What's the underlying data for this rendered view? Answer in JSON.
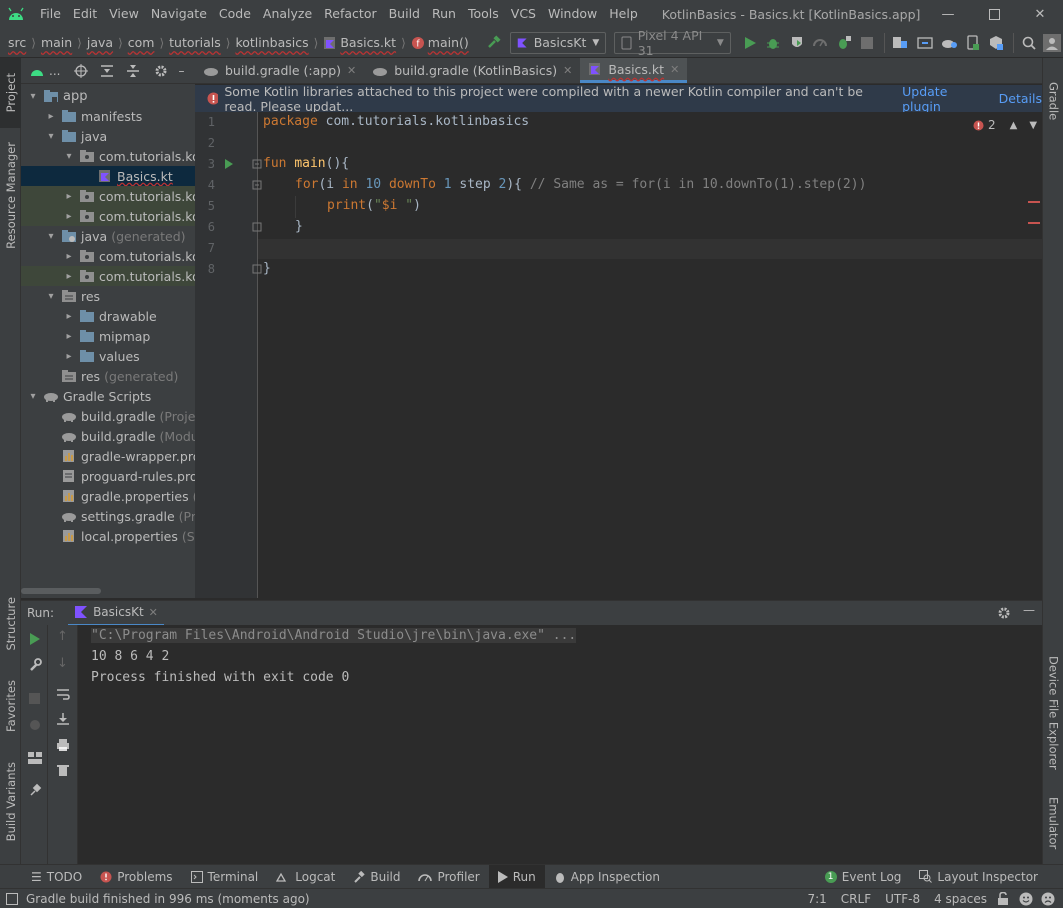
{
  "menu": [
    "File",
    "Edit",
    "View",
    "Navigate",
    "Code",
    "Analyze",
    "Refactor",
    "Build",
    "Run",
    "Tools",
    "VCS",
    "Window",
    "Help"
  ],
  "window_title": "KotlinBasics - Basics.kt [KotlinBasics.app]",
  "breadcrumbs": [
    "src",
    "main",
    "java",
    "com",
    "tutorials",
    "kotlinbasics",
    "Basics.kt",
    "main()"
  ],
  "run_config": "BasicsKt",
  "device": "Pixel 4 API 31",
  "left_tabs": {
    "project": "Project",
    "resource_manager": "Resource Manager",
    "structure": "Structure",
    "favorites": "Favorites",
    "build_variants": "Build Variants"
  },
  "right_tabs": {
    "gradle": "Gradle",
    "device_file_explorer": "Device File Explorer",
    "emulator": "Emulator"
  },
  "project_dropdown": "...",
  "tree": [
    {
      "label": "app",
      "extra": ""
    },
    {
      "label": "manifests",
      "extra": ""
    },
    {
      "label": "java",
      "extra": ""
    },
    {
      "label": "com.tutorials.kotli",
      "extra": ""
    },
    {
      "label": "Basics.kt",
      "extra": ""
    },
    {
      "label": "com.tutorials.kotli",
      "extra": ""
    },
    {
      "label": "com.tutorials.kotli",
      "extra": ""
    },
    {
      "label": "java",
      "extra": "(generated)"
    },
    {
      "label": "com.tutorials.kotli",
      "extra": ""
    },
    {
      "label": "com.tutorials.kotli",
      "extra": ""
    },
    {
      "label": "res",
      "extra": ""
    },
    {
      "label": "drawable",
      "extra": ""
    },
    {
      "label": "mipmap",
      "extra": ""
    },
    {
      "label": "values",
      "extra": ""
    },
    {
      "label": "res",
      "extra": "(generated)"
    },
    {
      "label": "Gradle Scripts",
      "extra": ""
    },
    {
      "label": "build.gradle",
      "extra": "(Project:"
    },
    {
      "label": "build.gradle",
      "extra": "(Module"
    },
    {
      "label": "gradle-wrapper.prope",
      "extra": ""
    },
    {
      "label": "proguard-rules.pro",
      "extra": "(P"
    },
    {
      "label": "gradle.properties",
      "extra": "(Pro"
    },
    {
      "label": "settings.gradle",
      "extra": "(Proje"
    },
    {
      "label": "local.properties",
      "extra": "(SDK"
    }
  ],
  "editor_tabs": [
    "build.gradle (:app)",
    "build.gradle (KotlinBasics)",
    "Basics.kt"
  ],
  "banner": {
    "message": "Some Kotlin libraries attached to this project were compiled with a newer Kotlin compiler and can't be read. Please updat...",
    "update": "Update plugin",
    "details": "Details"
  },
  "error_count": "2",
  "line_numbers": [
    "1",
    "2",
    "3",
    "4",
    "5",
    "6",
    "7",
    "8"
  ],
  "code": {
    "l1_kw": "package",
    "l1_rest": " com.tutorials.kotlinbasics",
    "l3_kw": "fun",
    "l3_fn": "main",
    "l3_rest": "(){",
    "l4_kw": "for",
    "l4_a": "(i ",
    "l4_in": "in",
    "l4_sp": " ",
    "l4_n1": "10",
    "l4_b": " ",
    "l4_dt": "downTo",
    "l4_c": " ",
    "l4_n2": "1",
    "l4_step": " step ",
    "l4_n3": "2",
    "l4_d": "){ ",
    "l4_cm": "// Same as = for(i in 10.downTo(1).step(2))",
    "l5_print": "print",
    "l5_a": "(",
    "l5_str1": "\"",
    "l5_var": "$i",
    "l5_str2": " \"",
    "l5_b": ")",
    "l6": "}",
    "l8": "}"
  },
  "run": {
    "label": "Run:",
    "tab": "BasicsKt"
  },
  "console": [
    "\"C:\\Program Files\\Android\\Android Studio\\jre\\bin\\java.exe\" ...",
    "10 8 6 4 2",
    "Process finished with exit code 0"
  ],
  "bottom_tabs": [
    "TODO",
    "Problems",
    "Terminal",
    "Logcat",
    "Build",
    "Profiler",
    "Run",
    "App Inspection"
  ],
  "event_log": {
    "label": "Event Log",
    "count": "1"
  },
  "layout_inspector": "Layout Inspector",
  "status": {
    "message": "Gradle build finished in 996 ms (moments ago)",
    "position": "7:1",
    "line_sep": "CRLF",
    "encoding": "UTF-8",
    "indent": "4 spaces"
  },
  "colors": {
    "accent": "#4a88c7",
    "run_green": "#499c54",
    "error": "#c75450",
    "link": "#589df6"
  }
}
